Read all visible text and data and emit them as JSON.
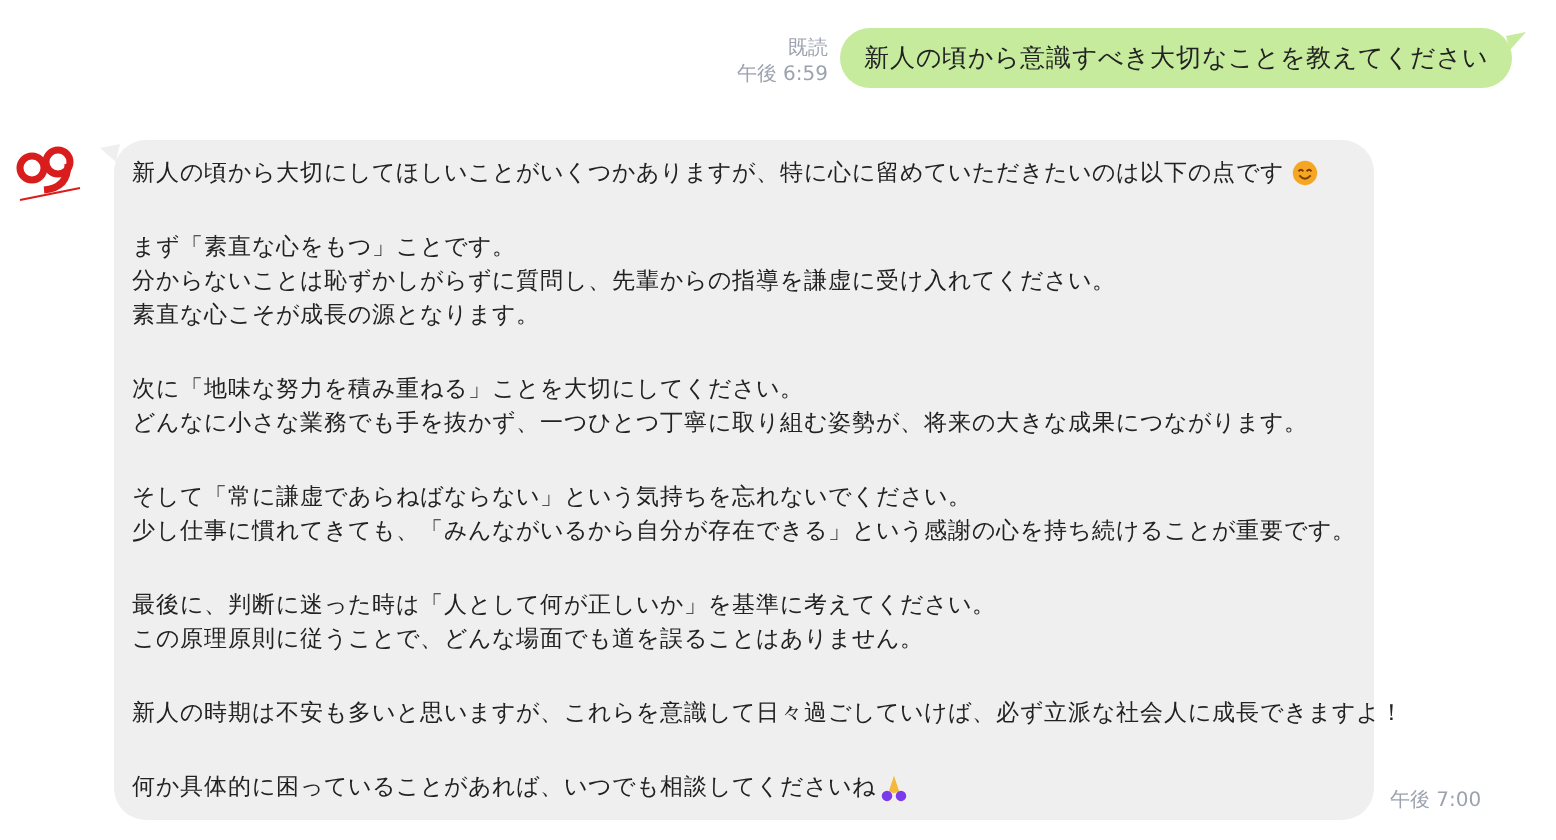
{
  "messages": [
    {
      "kind": "sent",
      "read_receipt": "既読",
      "time": "午後 6:59",
      "text": "新人の頃から意識すべき大切なことを教えてください"
    },
    {
      "kind": "received",
      "time": "午後 7:00",
      "paragraphs": [
        {
          "lines": [
            {
              "text": "新人の頃から大切にしてほしいことがいくつかありますが、特に心に留めていただきたいのは以下の点です",
              "kind": "smile"
            }
          ]
        },
        {
          "lines": [
            {
              "text": "まず「素直な心をもつ」ことです。"
            },
            {
              "text": "分からないことは恥ずかしがらずに質問し、先輩からの指導を謙虚に受け入れてください。"
            },
            {
              "text": "素直な心こそが成長の源となります。"
            }
          ]
        },
        {
          "lines": [
            {
              "text": "次に「地味な努力を積み重ねる」ことを大切にしてください。"
            },
            {
              "text": "どんなに小さな業務でも手を抜かず、一つひとつ丁寧に取り組む姿勢が、将来の大きな成果につながります。"
            }
          ]
        },
        {
          "lines": [
            {
              "text": "そして「常に謙虚であらねばならない」という気持ちを忘れないでください。"
            },
            {
              "text": "少し仕事に慣れてきても、「みんながいるから自分が存在できる」という感謝の心を持ち続けることが重要です。"
            }
          ]
        },
        {
          "lines": [
            {
              "text": "最後に、判断に迷った時は「人として何が正しいか」を基準に考えてください。"
            },
            {
              "text": "この原理原則に従うことで、どんな場面でも道を誤ることはありません。"
            }
          ]
        },
        {
          "lines": [
            {
              "text": "新人の時期は不安も多いと思いますが、これらを意識して日々過ごしていけば、必ず立派な社会人に成長できますよ！"
            }
          ]
        },
        {
          "lines": [
            {
              "text": "何か具体的に困っていることがあれば、いつでも相談してくださいね",
              "kind": "pray"
            }
          ]
        }
      ]
    }
  ]
}
